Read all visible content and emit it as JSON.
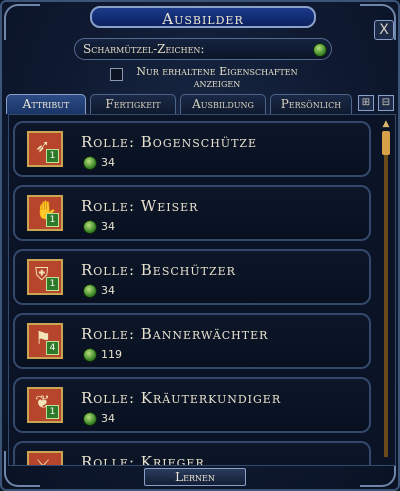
{
  "window": {
    "title": "Ausbilder",
    "close_glyph": "X"
  },
  "currency": {
    "label": "Scharmützel-Zeichen:",
    "icon": "skirmish-mark-coin-icon"
  },
  "filter": {
    "label": "Nur erhaltene Eigenschaften anzeigen",
    "checked": false
  },
  "tabs": [
    {
      "label": "Attribut",
      "active": true
    },
    {
      "label": "Fertigkeit",
      "active": false
    },
    {
      "label": "Ausbildung",
      "active": false
    },
    {
      "label": "Persönlich",
      "active": false
    }
  ],
  "tab_icons": [
    "expand-icon",
    "collapse-icon"
  ],
  "rows": [
    {
      "title": "Rolle: Bogenschütze",
      "cost": "34",
      "rank": "1",
      "icon": "archer-icon"
    },
    {
      "title": "Rolle: Weiser",
      "cost": "34",
      "rank": "1",
      "icon": "sage-icon"
    },
    {
      "title": "Rolle: Beschützer",
      "cost": "34",
      "rank": "1",
      "icon": "protector-icon"
    },
    {
      "title": "Rolle: Bannerwächter",
      "cost": "119",
      "rank": "4",
      "icon": "banner-icon"
    },
    {
      "title": "Rolle: Kräuterkundiger",
      "cost": "34",
      "rank": "1",
      "icon": "herbalist-icon"
    },
    {
      "title": "Rolle: Krieger",
      "cost": "",
      "rank": "",
      "icon": "warrior-icon"
    }
  ],
  "footer": {
    "learn_label": "Lernen"
  },
  "colors": {
    "accent": "#1b3a8a",
    "coin_green": "#3f8a2a",
    "icon_red": "#b6452b"
  }
}
